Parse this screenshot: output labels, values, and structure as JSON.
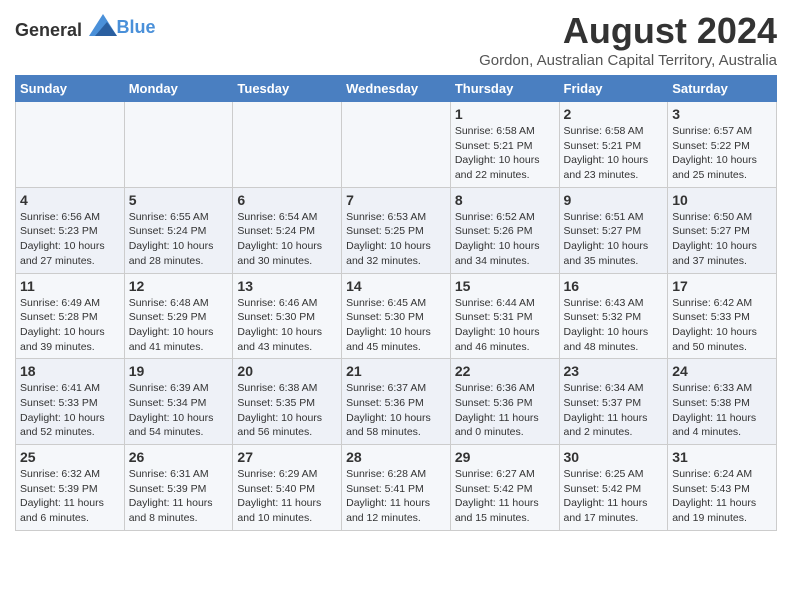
{
  "header": {
    "logo_general": "General",
    "logo_blue": "Blue",
    "month_year": "August 2024",
    "location": "Gordon, Australian Capital Territory, Australia"
  },
  "days_of_week": [
    "Sunday",
    "Monday",
    "Tuesday",
    "Wednesday",
    "Thursday",
    "Friday",
    "Saturday"
  ],
  "weeks": [
    [
      {
        "day": "",
        "text": ""
      },
      {
        "day": "",
        "text": ""
      },
      {
        "day": "",
        "text": ""
      },
      {
        "day": "",
        "text": ""
      },
      {
        "day": "1",
        "text": "Sunrise: 6:58 AM\nSunset: 5:21 PM\nDaylight: 10 hours and 22 minutes."
      },
      {
        "day": "2",
        "text": "Sunrise: 6:58 AM\nSunset: 5:21 PM\nDaylight: 10 hours and 23 minutes."
      },
      {
        "day": "3",
        "text": "Sunrise: 6:57 AM\nSunset: 5:22 PM\nDaylight: 10 hours and 25 minutes."
      }
    ],
    [
      {
        "day": "4",
        "text": "Sunrise: 6:56 AM\nSunset: 5:23 PM\nDaylight: 10 hours and 27 minutes."
      },
      {
        "day": "5",
        "text": "Sunrise: 6:55 AM\nSunset: 5:24 PM\nDaylight: 10 hours and 28 minutes."
      },
      {
        "day": "6",
        "text": "Sunrise: 6:54 AM\nSunset: 5:24 PM\nDaylight: 10 hours and 30 minutes."
      },
      {
        "day": "7",
        "text": "Sunrise: 6:53 AM\nSunset: 5:25 PM\nDaylight: 10 hours and 32 minutes."
      },
      {
        "day": "8",
        "text": "Sunrise: 6:52 AM\nSunset: 5:26 PM\nDaylight: 10 hours and 34 minutes."
      },
      {
        "day": "9",
        "text": "Sunrise: 6:51 AM\nSunset: 5:27 PM\nDaylight: 10 hours and 35 minutes."
      },
      {
        "day": "10",
        "text": "Sunrise: 6:50 AM\nSunset: 5:27 PM\nDaylight: 10 hours and 37 minutes."
      }
    ],
    [
      {
        "day": "11",
        "text": "Sunrise: 6:49 AM\nSunset: 5:28 PM\nDaylight: 10 hours and 39 minutes."
      },
      {
        "day": "12",
        "text": "Sunrise: 6:48 AM\nSunset: 5:29 PM\nDaylight: 10 hours and 41 minutes."
      },
      {
        "day": "13",
        "text": "Sunrise: 6:46 AM\nSunset: 5:30 PM\nDaylight: 10 hours and 43 minutes."
      },
      {
        "day": "14",
        "text": "Sunrise: 6:45 AM\nSunset: 5:30 PM\nDaylight: 10 hours and 45 minutes."
      },
      {
        "day": "15",
        "text": "Sunrise: 6:44 AM\nSunset: 5:31 PM\nDaylight: 10 hours and 46 minutes."
      },
      {
        "day": "16",
        "text": "Sunrise: 6:43 AM\nSunset: 5:32 PM\nDaylight: 10 hours and 48 minutes."
      },
      {
        "day": "17",
        "text": "Sunrise: 6:42 AM\nSunset: 5:33 PM\nDaylight: 10 hours and 50 minutes."
      }
    ],
    [
      {
        "day": "18",
        "text": "Sunrise: 6:41 AM\nSunset: 5:33 PM\nDaylight: 10 hours and 52 minutes."
      },
      {
        "day": "19",
        "text": "Sunrise: 6:39 AM\nSunset: 5:34 PM\nDaylight: 10 hours and 54 minutes."
      },
      {
        "day": "20",
        "text": "Sunrise: 6:38 AM\nSunset: 5:35 PM\nDaylight: 10 hours and 56 minutes."
      },
      {
        "day": "21",
        "text": "Sunrise: 6:37 AM\nSunset: 5:36 PM\nDaylight: 10 hours and 58 minutes."
      },
      {
        "day": "22",
        "text": "Sunrise: 6:36 AM\nSunset: 5:36 PM\nDaylight: 11 hours and 0 minutes."
      },
      {
        "day": "23",
        "text": "Sunrise: 6:34 AM\nSunset: 5:37 PM\nDaylight: 11 hours and 2 minutes."
      },
      {
        "day": "24",
        "text": "Sunrise: 6:33 AM\nSunset: 5:38 PM\nDaylight: 11 hours and 4 minutes."
      }
    ],
    [
      {
        "day": "25",
        "text": "Sunrise: 6:32 AM\nSunset: 5:39 PM\nDaylight: 11 hours and 6 minutes."
      },
      {
        "day": "26",
        "text": "Sunrise: 6:31 AM\nSunset: 5:39 PM\nDaylight: 11 hours and 8 minutes."
      },
      {
        "day": "27",
        "text": "Sunrise: 6:29 AM\nSunset: 5:40 PM\nDaylight: 11 hours and 10 minutes."
      },
      {
        "day": "28",
        "text": "Sunrise: 6:28 AM\nSunset: 5:41 PM\nDaylight: 11 hours and 12 minutes."
      },
      {
        "day": "29",
        "text": "Sunrise: 6:27 AM\nSunset: 5:42 PM\nDaylight: 11 hours and 15 minutes."
      },
      {
        "day": "30",
        "text": "Sunrise: 6:25 AM\nSunset: 5:42 PM\nDaylight: 11 hours and 17 minutes."
      },
      {
        "day": "31",
        "text": "Sunrise: 6:24 AM\nSunset: 5:43 PM\nDaylight: 11 hours and 19 minutes."
      }
    ]
  ]
}
